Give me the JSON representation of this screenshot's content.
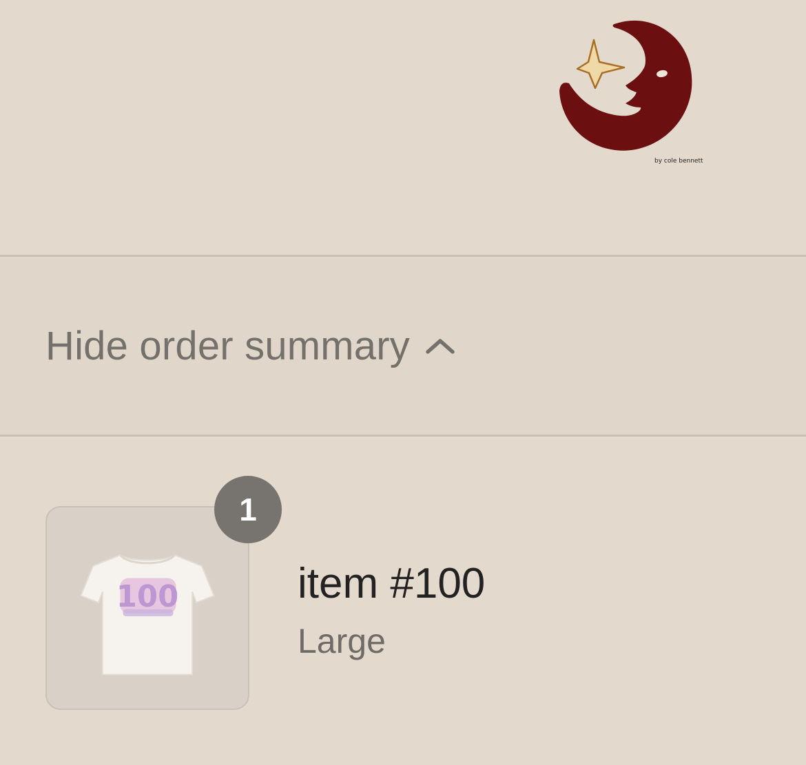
{
  "brand": {
    "logo_icon": "moon-star-logo-icon",
    "logo_caption": "by cole bennett",
    "logo_color": "#6b0f10",
    "star_color": "#efd9a6"
  },
  "order_summary": {
    "toggle_label": "Hide order summary",
    "toggle_icon": "chevron-up-icon"
  },
  "line_items": [
    {
      "quantity": "1",
      "name": "item #100",
      "variant": "Large",
      "image_icon": "tshirt-product-image"
    }
  ]
}
